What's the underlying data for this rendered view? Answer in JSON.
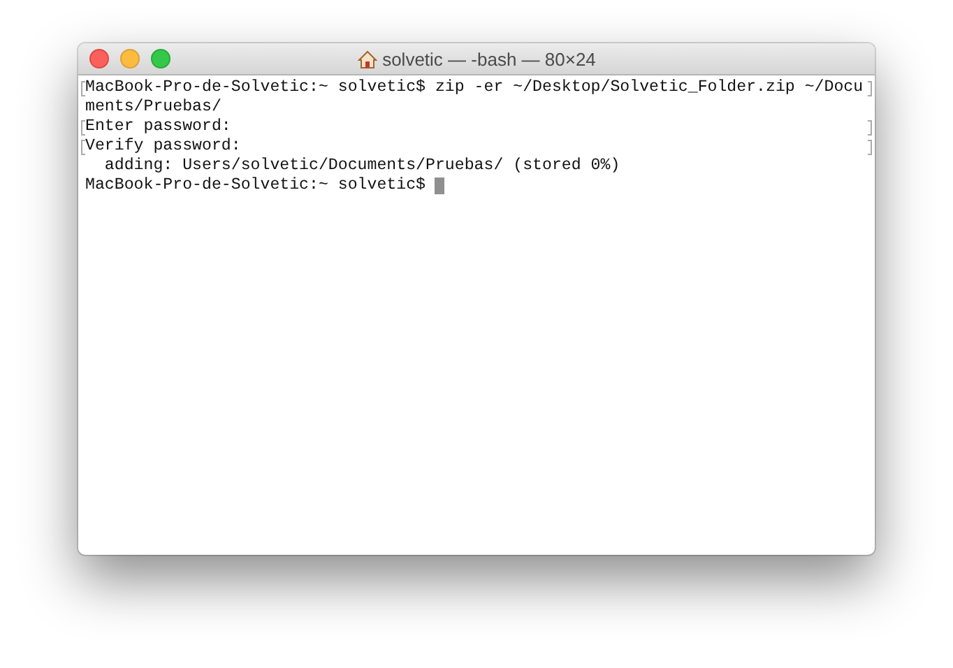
{
  "window": {
    "title": "solvetic — -bash — 80×24"
  },
  "terminal": {
    "lines": [
      {
        "text": "MacBook-Pro-de-Solvetic:~ solvetic$ zip -er ~/Desktop/Solvetic_Folder.zip ~/Docu",
        "marked": true
      },
      {
        "text": "ments/Pruebas/",
        "marked": false
      },
      {
        "text": "Enter password:",
        "marked": true
      },
      {
        "text": "Verify password:",
        "marked": true
      },
      {
        "text": "  adding: Users/solvetic/Documents/Pruebas/ (stored 0%)",
        "marked": false
      },
      {
        "text": "MacBook-Pro-de-Solvetic:~ solvetic$ ",
        "marked": false,
        "cursor": true
      }
    ]
  }
}
